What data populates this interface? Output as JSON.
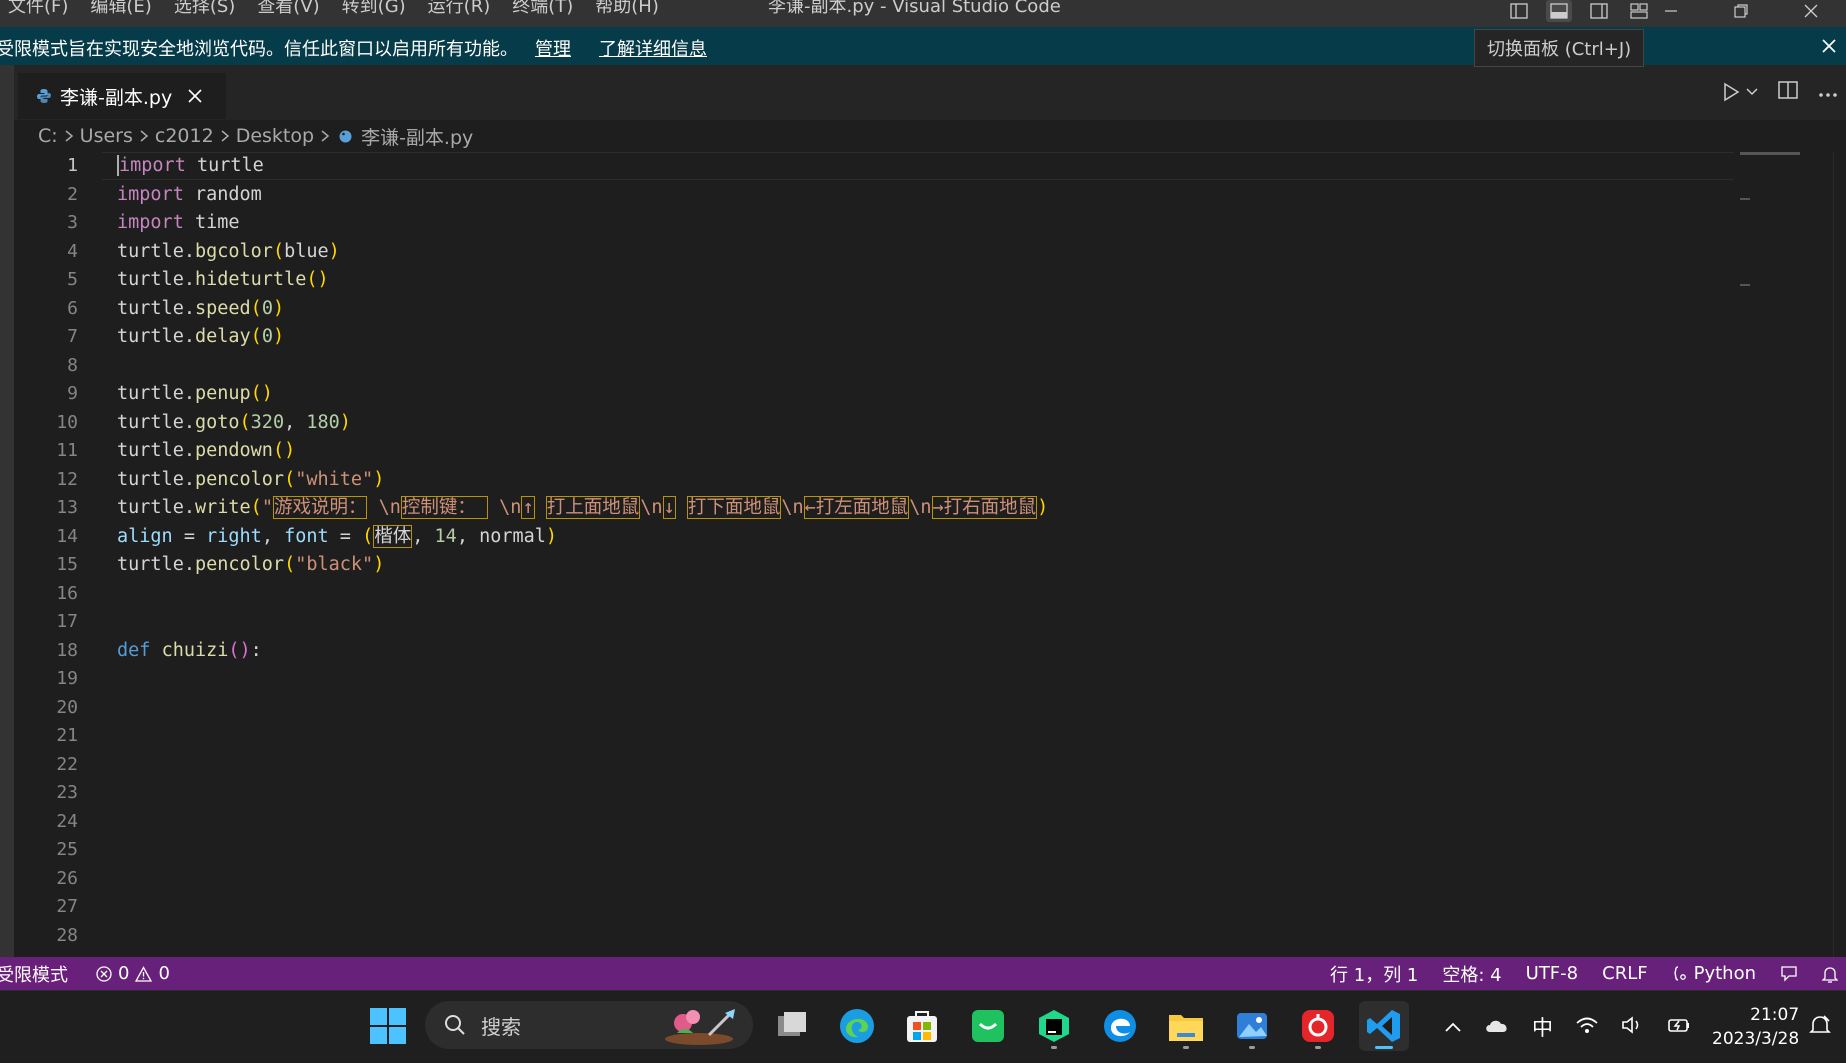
{
  "titlebar": {
    "menu": [
      "文件(F)",
      "编辑(E)",
      "选择(S)",
      "查看(V)",
      "转到(G)",
      "运行(R)",
      "终端(T)",
      "帮助(H)"
    ],
    "title": "李谦-副本.py - Visual Studio Code"
  },
  "banner": {
    "message": "受限模式旨在实现安全地浏览代码。信任此窗口以启用所有功能。",
    "manage": "管理",
    "learn_more": "了解详细信息"
  },
  "tooltip": "切换面板 (Ctrl+J)",
  "tab": {
    "label": "李谦-副本.py"
  },
  "breadcrumb": [
    "C:",
    "Users",
    "c2012",
    "Desktop",
    "李谦-副本.py"
  ],
  "editor": {
    "line_numbers": [
      "1",
      "2",
      "3",
      "4",
      "5",
      "6",
      "7",
      "8",
      "9",
      "10",
      "11",
      "12",
      "13",
      "14",
      "15",
      "16",
      "17",
      "18",
      "19",
      "20",
      "21",
      "22",
      "23",
      "24",
      "25",
      "26",
      "27",
      "28"
    ],
    "active_line": 1,
    "lines": [
      [
        {
          "c": "kw",
          "t": "import"
        },
        {
          "c": "",
          "t": " turtle"
        }
      ],
      [
        {
          "c": "kw",
          "t": "import"
        },
        {
          "c": "",
          "t": " random"
        }
      ],
      [
        {
          "c": "kw",
          "t": "import"
        },
        {
          "c": "",
          "t": " time"
        }
      ],
      [
        {
          "c": "",
          "t": "turtle."
        },
        {
          "c": "fn",
          "t": "bgcolor"
        },
        {
          "c": "p1",
          "t": "("
        },
        {
          "c": "",
          "t": "blue"
        },
        {
          "c": "p1",
          "t": ")"
        }
      ],
      [
        {
          "c": "",
          "t": "turtle."
        },
        {
          "c": "fn",
          "t": "hideturtle"
        },
        {
          "c": "p1",
          "t": "()"
        }
      ],
      [
        {
          "c": "",
          "t": "turtle."
        },
        {
          "c": "fn",
          "t": "speed"
        },
        {
          "c": "p1",
          "t": "("
        },
        {
          "c": "num",
          "t": "0"
        },
        {
          "c": "p1",
          "t": ")"
        }
      ],
      [
        {
          "c": "",
          "t": "turtle."
        },
        {
          "c": "fn",
          "t": "delay"
        },
        {
          "c": "p1",
          "t": "("
        },
        {
          "c": "num",
          "t": "0"
        },
        {
          "c": "p1",
          "t": ")"
        }
      ],
      [],
      [
        {
          "c": "",
          "t": "turtle."
        },
        {
          "c": "fn",
          "t": "penup"
        },
        {
          "c": "p1",
          "t": "()"
        }
      ],
      [
        {
          "c": "",
          "t": "turtle."
        },
        {
          "c": "fn",
          "t": "goto"
        },
        {
          "c": "p1",
          "t": "("
        },
        {
          "c": "num",
          "t": "320"
        },
        {
          "c": "",
          "t": ", "
        },
        {
          "c": "num",
          "t": "180"
        },
        {
          "c": "p1",
          "t": ")"
        }
      ],
      [
        {
          "c": "",
          "t": "turtle."
        },
        {
          "c": "fn",
          "t": "pendown"
        },
        {
          "c": "p1",
          "t": "()"
        }
      ],
      [
        {
          "c": "",
          "t": "turtle."
        },
        {
          "c": "fn",
          "t": "pencolor"
        },
        {
          "c": "p1",
          "t": "("
        },
        {
          "c": "str",
          "t": "\"white\""
        },
        {
          "c": "p1",
          "t": ")"
        }
      ],
      [
        {
          "c": "",
          "t": "turtle."
        },
        {
          "c": "fn",
          "t": "write"
        },
        {
          "c": "p1",
          "t": "("
        },
        {
          "c": "str",
          "t": "\""
        },
        {
          "c": "str hl",
          "t": "游戏说明："
        },
        {
          "c": "str",
          "t": " \\n"
        },
        {
          "c": "str hl",
          "t": "控制键： "
        },
        {
          "c": "str",
          "t": " \\n"
        },
        {
          "c": "str hl",
          "t": "↑"
        },
        {
          "c": "str",
          "t": " "
        },
        {
          "c": "str hl",
          "t": "打上面地鼠"
        },
        {
          "c": "str",
          "t": "\\n"
        },
        {
          "c": "str hl",
          "t": "↓"
        },
        {
          "c": "str",
          "t": " "
        },
        {
          "c": "str hl",
          "t": "打下面地鼠"
        },
        {
          "c": "str",
          "t": "\\n"
        },
        {
          "c": "str hl",
          "t": "←打左面地鼠"
        },
        {
          "c": "str",
          "t": "\\n"
        },
        {
          "c": "str hl",
          "t": "→打右面地鼠"
        },
        {
          "c": "p1",
          "t": ")"
        }
      ],
      [
        {
          "c": "id",
          "t": "align"
        },
        {
          "c": "",
          "t": " = "
        },
        {
          "c": "id",
          "t": "right"
        },
        {
          "c": "",
          "t": ", "
        },
        {
          "c": "id",
          "t": "font"
        },
        {
          "c": "",
          "t": " = "
        },
        {
          "c": "p1",
          "t": "("
        },
        {
          "c": "hl",
          "t": "楷体"
        },
        {
          "c": "",
          "t": ", "
        },
        {
          "c": "num",
          "t": "14"
        },
        {
          "c": "",
          "t": ", normal"
        },
        {
          "c": "p1",
          "t": ")"
        }
      ],
      [
        {
          "c": "",
          "t": "turtle."
        },
        {
          "c": "fn",
          "t": "pencolor"
        },
        {
          "c": "p1",
          "t": "("
        },
        {
          "c": "str",
          "t": "\"black\""
        },
        {
          "c": "p1",
          "t": ")"
        }
      ],
      [],
      [],
      [
        {
          "c": "kw2",
          "t": "def"
        },
        {
          "c": "",
          "t": " "
        },
        {
          "c": "fn",
          "t": "chuizi"
        },
        {
          "c": "p2",
          "t": "()"
        },
        {
          "c": "",
          "t": ":"
        }
      ],
      [],
      [],
      [],
      [],
      [],
      [],
      [],
      [],
      [],
      []
    ]
  },
  "statusbar": {
    "restricted": "受限模式",
    "errors": "0",
    "warnings": "0",
    "position": "行 1，列 1",
    "spaces": "空格: 4",
    "encoding": "UTF-8",
    "eol": "CRLF",
    "language": "Python"
  },
  "taskbar": {
    "search_label": "搜索",
    "ime": "中",
    "time": "21:07",
    "date": "2023/3/28"
  },
  "colors": {
    "statusbar": "#68217a",
    "banner": "#063b49",
    "accent": "#007acc"
  }
}
